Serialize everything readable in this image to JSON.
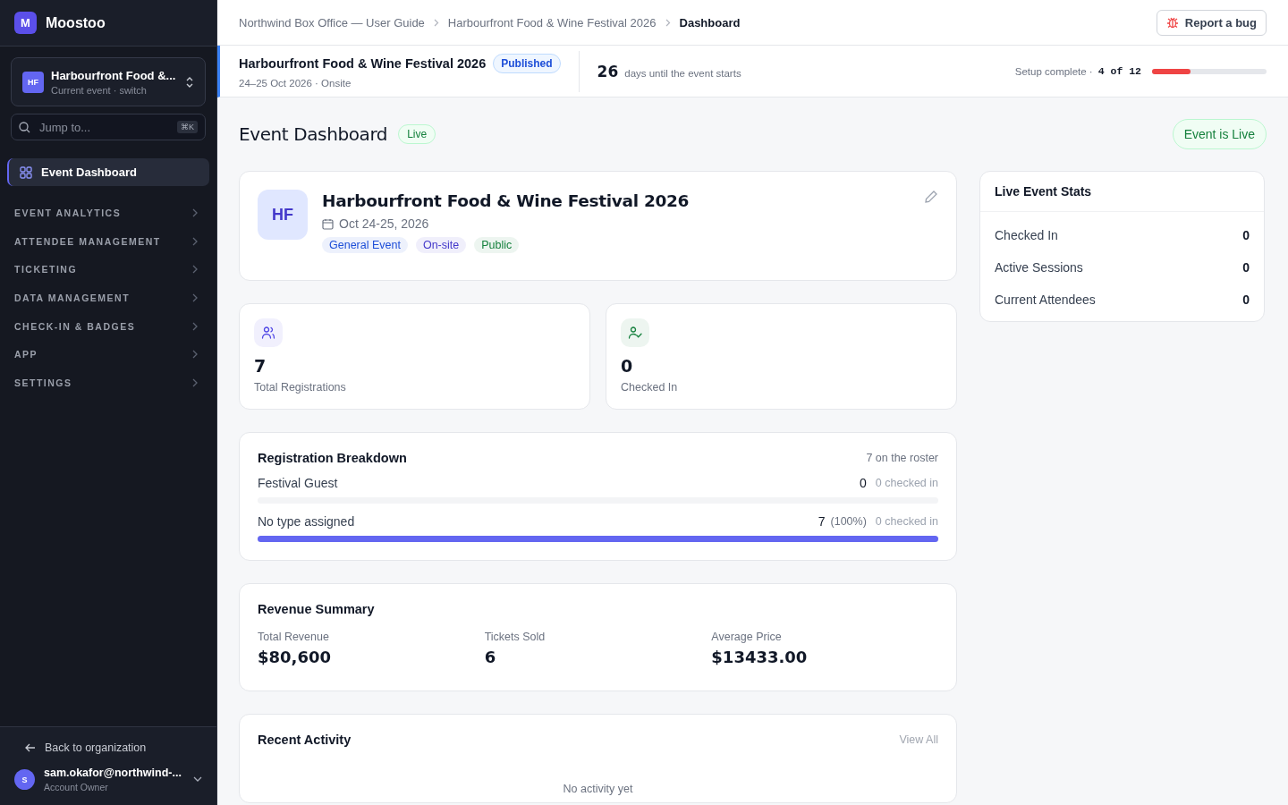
{
  "sidebar": {
    "brand": {
      "logo": "M",
      "name": "Moostoo"
    },
    "event_switcher": {
      "initials": "HF",
      "title": "Harbourfront Food &...",
      "subtitle": "Current event · switch"
    },
    "search": {
      "placeholder": "Jump to...",
      "shortcut": "⌘K"
    },
    "nav": [
      {
        "label": "Event Dashboard",
        "kind": "link",
        "selected": true
      },
      {
        "label": "EVENT ANALYTICS",
        "kind": "section",
        "selected": false
      },
      {
        "label": "ATTENDEE MANAGEMENT",
        "kind": "section",
        "selected": false
      },
      {
        "label": "TICKETING",
        "kind": "section",
        "selected": false
      },
      {
        "label": "DATA MANAGEMENT",
        "kind": "section",
        "selected": false
      },
      {
        "label": "CHECK-IN & BADGES",
        "kind": "section",
        "selected": false
      },
      {
        "label": "APP",
        "kind": "section",
        "selected": false
      },
      {
        "label": "SETTINGS",
        "kind": "section",
        "selected": false
      }
    ],
    "back_link": "Back to organization",
    "user": {
      "initial": "S",
      "email": "sam.okafor@northwind-...",
      "role": "Account Owner"
    }
  },
  "breadcrumbs": [
    {
      "label": "Northwind Box Office — User Guide",
      "selected": false
    },
    {
      "label": "Harbourfront Food & Wine Festival 2026",
      "selected": false
    },
    {
      "label": "Dashboard",
      "selected": true
    }
  ],
  "report_button": "Report a bug",
  "event_strip": {
    "title": "Harbourfront Food & Wine Festival 2026",
    "status": "Published",
    "subtitle": "24–25 Oct 2026 · Onsite",
    "countdown": "26",
    "countdown_label": "days until the event starts",
    "setup": {
      "label": "Setup complete ·",
      "count": "4 of 12",
      "level": 0.333
    }
  },
  "page_title": "Event Dashboard",
  "title_badge": "Live",
  "live_button": "Event is Live",
  "event_card": {
    "initials": "HF",
    "title": "Harbourfront Food & Wine Festival 2026",
    "date": "Oct 24-25, 2026",
    "tags": [
      {
        "label": "General Event",
        "color": "#1d4ed8"
      },
      {
        "label": "On-site",
        "color": "#4338ca"
      },
      {
        "label": "Public",
        "color": "#15803d"
      }
    ]
  },
  "stats": [
    {
      "kind": "people",
      "value": "7",
      "label": "Total Registrations",
      "color": "#4f46e5"
    },
    {
      "kind": "checkin",
      "value": "0",
      "label": "Checked In",
      "color": "#15803d"
    }
  ],
  "breakdown": {
    "title": "Registration Breakdown",
    "summary": "7 on the roster",
    "rows": [
      {
        "name": "Festival Guest",
        "count": "0",
        "checked": "0 checked in",
        "level": 0
      },
      {
        "name": "No type assigned",
        "count": "7",
        "percent": "(100%)",
        "checked": "0 checked in",
        "level": 1
      }
    ]
  },
  "revenue": {
    "title": "Revenue Summary",
    "items": [
      {
        "label": "Total Revenue",
        "value": "$80,600"
      },
      {
        "label": "Tickets Sold",
        "value": "6"
      },
      {
        "label": "Average Price",
        "value": "$13433.00"
      }
    ]
  },
  "activity": {
    "title": "Recent Activity",
    "link": "View All",
    "empty": "No activity yet"
  },
  "live_stats": {
    "title": "Live Event Stats",
    "rows": [
      {
        "label": "Checked In",
        "value": "0"
      },
      {
        "label": "Active Sessions",
        "value": "0"
      },
      {
        "label": "Current Attendees",
        "value": "0"
      }
    ]
  }
}
